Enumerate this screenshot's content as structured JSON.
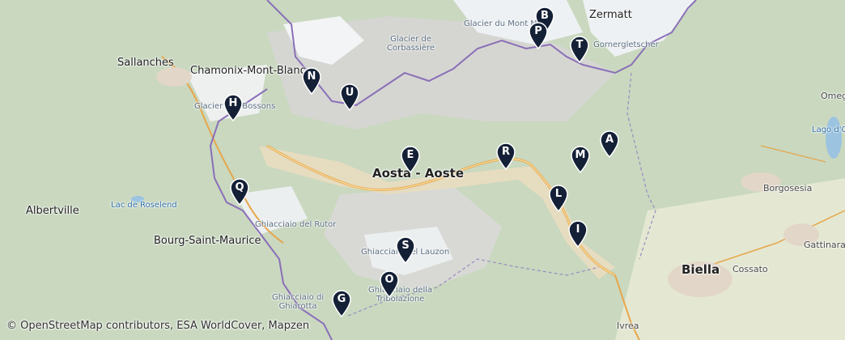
{
  "map": {
    "attribution": "© OpenStreetMap contributors, ESA WorldCover, Mapzen",
    "places": [
      {
        "id": "aosta",
        "name": "Aosta - Aoste"
      },
      {
        "id": "zermatt",
        "name": "Zermatt"
      },
      {
        "id": "sallanches",
        "name": "Sallanches"
      },
      {
        "id": "chamonix",
        "name": "Chamonix-Mont-Blanc"
      },
      {
        "id": "albertville",
        "name": "Albertville"
      },
      {
        "id": "bourg",
        "name": "Bourg-Saint-Maurice"
      },
      {
        "id": "biella",
        "name": "Biella"
      },
      {
        "id": "cossato",
        "name": "Cossato"
      },
      {
        "id": "ivrea",
        "name": "Ivrea"
      },
      {
        "id": "borgosesia",
        "name": "Borgosesia"
      },
      {
        "id": "gattinara",
        "name": "Gattinara"
      },
      {
        "id": "omegna",
        "name": "Omeg"
      },
      {
        "id": "glacier-corbassiere",
        "name": "Glacier de\nCorbassière"
      },
      {
        "id": "glacier-mont-mine",
        "name": "Glacier du Mont Mi"
      },
      {
        "id": "gornergletscher",
        "name": "Gornergletscher"
      },
      {
        "id": "glacier-bossons",
        "name": "Glacier des Bossons"
      },
      {
        "id": "lac-roselend",
        "name": "Lac de Roselend"
      },
      {
        "id": "lago-orta",
        "name": "Lago d'Or"
      },
      {
        "id": "ghiacciaio-rutor",
        "name": "Ghiacciaio del Rutor"
      },
      {
        "id": "ghiacciaio-gran-paradiso",
        "name": "Ghiacciaio del Lauzon"
      },
      {
        "id": "ghiacciaio-tribolazione",
        "name": "Ghiacciaio della\nTribolazione"
      },
      {
        "id": "ghiacciaio-grande-rousse",
        "name": "Ghiacciaio di\nGhiarotta"
      }
    ],
    "markers": [
      {
        "letter": "A"
      },
      {
        "letter": "B"
      },
      {
        "letter": "E"
      },
      {
        "letter": "G"
      },
      {
        "letter": "H"
      },
      {
        "letter": "I"
      },
      {
        "letter": "L"
      },
      {
        "letter": "M"
      },
      {
        "letter": "N"
      },
      {
        "letter": "O"
      },
      {
        "letter": "P"
      },
      {
        "letter": "Q"
      },
      {
        "letter": "R"
      },
      {
        "letter": "S"
      },
      {
        "letter": "T"
      },
      {
        "letter": "U"
      }
    ]
  }
}
